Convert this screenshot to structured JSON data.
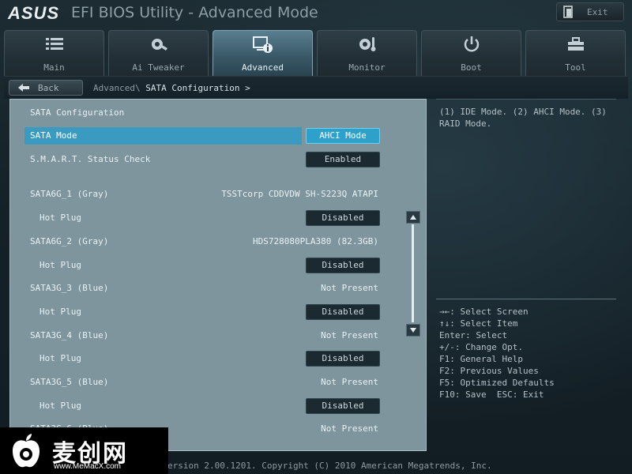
{
  "titlebar": {
    "logo": "ASUS",
    "title": "EFI BIOS Utility - Advanced Mode",
    "exit_label": "Exit"
  },
  "tabs": [
    {
      "label": "Main",
      "icon": "list-icon"
    },
    {
      "label": "Ai Tweaker",
      "icon": "tweaker-icon"
    },
    {
      "label": "Advanced",
      "icon": "advanced-icon",
      "active": true
    },
    {
      "label": "Monitor",
      "icon": "monitor-icon"
    },
    {
      "label": "Boot",
      "icon": "power-icon"
    },
    {
      "label": "Tool",
      "icon": "toolbox-icon"
    }
  ],
  "breadcrumb": {
    "back_label": "Back",
    "parent": "Advanced\\",
    "current": "SATA Configuration >"
  },
  "panel": {
    "section_title": "SATA Configuration",
    "rows": [
      {
        "label": "SATA Mode",
        "button": "AHCI Mode",
        "selected": true
      },
      {
        "label": "S.M.A.R.T. Status Check",
        "button": "Enabled"
      },
      {
        "label": "SATA6G_1 (Gray)",
        "value": "TSSTcorp CDDVDW SH-S223Q ATAPI"
      },
      {
        "label": "Hot Plug",
        "button": "Disabled",
        "sub": true
      },
      {
        "label": "SATA6G_2 (Gray)",
        "value": "HDS728080PLA380 (82.3GB)"
      },
      {
        "label": "Hot Plug",
        "button": "Disabled",
        "sub": true
      },
      {
        "label": "SATA3G_3 (Blue)",
        "value": "Not Present"
      },
      {
        "label": "Hot Plug",
        "button": "Disabled",
        "sub": true
      },
      {
        "label": "SATA3G_4 (Blue)",
        "value": "Not Present"
      },
      {
        "label": "Hot Plug",
        "button": "Disabled",
        "sub": true
      },
      {
        "label": "SATA3G_5 (Blue)",
        "value": "Not Present"
      },
      {
        "label": "Hot Plug",
        "button": "Disabled",
        "sub": true
      },
      {
        "label": "SATA3G_6 (Blue)",
        "value": "Not Present"
      }
    ]
  },
  "help": {
    "description": "(1) IDE Mode. (2) AHCI Mode. (3) RAID Mode.",
    "keys": [
      "→←: Select Screen",
      "↑↓: Select Item",
      "Enter: Select",
      "+/-: Change Opt.",
      "F1: General Help",
      "F2: Previous Values",
      "F5: Optimized Defaults",
      "F10: Save  ESC: Exit"
    ]
  },
  "footer": "ersion 2.00.1201. Copyright (C) 2010 American Megatrends, Inc.",
  "watermark": {
    "text": "麦创网",
    "url": "www.MeMacX.com"
  },
  "colors": {
    "panel": "#7e959e",
    "selected": "#3a9ac0",
    "active_tab": "#4a7080"
  }
}
